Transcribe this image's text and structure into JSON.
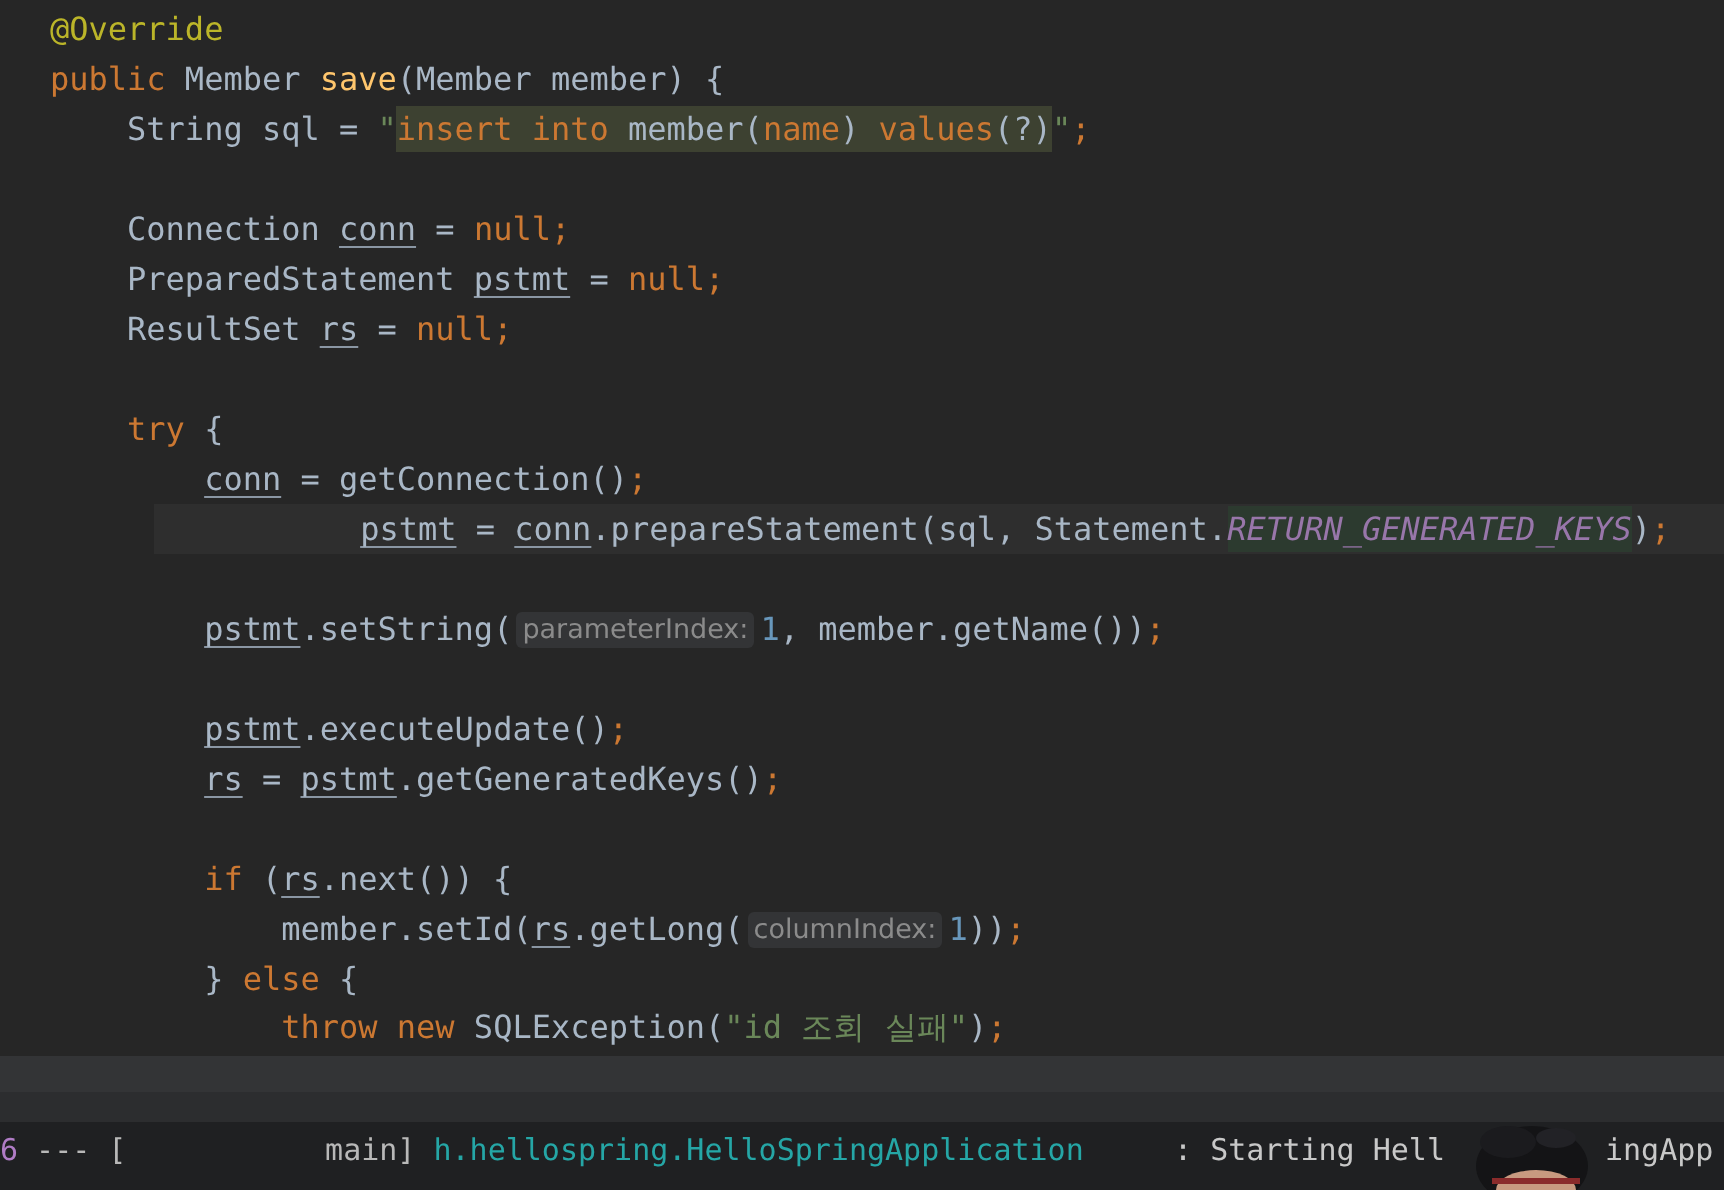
{
  "editor": {
    "lines": [
      {
        "kind": "code",
        "segments": [
          {
            "kind": "text",
            "tokens": [
              {
                "text": "@Override",
                "kind": "annotation"
              }
            ]
          }
        ]
      },
      {
        "kind": "code",
        "segments": [
          {
            "kind": "text",
            "tokens": [
              {
                "text": "public",
                "kind": "keyword"
              },
              {
                "text": " Member ",
                "kind": "plain"
              },
              {
                "text": "save",
                "kind": "method"
              },
              {
                "text": "(Member member) {",
                "kind": "plain"
              }
            ]
          }
        ],
        "children": [
          {
            "kind": "code",
            "segments": [
              {
                "kind": "text",
                "tokens": [
                  {
                    "text": "String sql = ",
                    "kind": "plain"
                  },
                  {
                    "text": "\"",
                    "kind": "string"
                  }
                ]
              },
              {
                "kind": "injection",
                "tokens": [
                  {
                    "text": "insert into",
                    "kind": "keyword"
                  },
                  {
                    "text": " member(",
                    "kind": "plain"
                  },
                  {
                    "text": "name",
                    "kind": "keyword"
                  },
                  {
                    "text": ") ",
                    "kind": "plain"
                  },
                  {
                    "text": "values",
                    "kind": "keyword"
                  },
                  {
                    "text": "(?)",
                    "kind": "plain"
                  }
                ]
              },
              {
                "kind": "text",
                "tokens": [
                  {
                    "text": "\"",
                    "kind": "string"
                  },
                  {
                    "text": ";",
                    "kind": "keyword"
                  }
                ]
              }
            ]
          },
          {
            "kind": "blank"
          },
          {
            "kind": "code",
            "segments": [
              {
                "kind": "text",
                "tokens": [
                  {
                    "text": "Connection ",
                    "kind": "plain"
                  },
                  {
                    "text": "conn",
                    "kind": "plain",
                    "underline": true
                  },
                  {
                    "text": " = ",
                    "kind": "plain"
                  },
                  {
                    "text": "null;",
                    "kind": "keyword"
                  }
                ]
              }
            ]
          },
          {
            "kind": "code",
            "segments": [
              {
                "kind": "text",
                "tokens": [
                  {
                    "text": "PreparedStatement ",
                    "kind": "plain"
                  },
                  {
                    "text": "pstmt",
                    "kind": "plain",
                    "underline": true
                  },
                  {
                    "text": " = ",
                    "kind": "plain"
                  },
                  {
                    "text": "null;",
                    "kind": "keyword"
                  }
                ]
              }
            ]
          },
          {
            "kind": "code",
            "segments": [
              {
                "kind": "text",
                "tokens": [
                  {
                    "text": "ResultSet ",
                    "kind": "plain"
                  },
                  {
                    "text": "rs",
                    "kind": "plain",
                    "underline": true
                  },
                  {
                    "text": " = ",
                    "kind": "plain"
                  },
                  {
                    "text": "null;",
                    "kind": "keyword"
                  }
                ]
              }
            ]
          },
          {
            "kind": "blank"
          },
          {
            "kind": "code",
            "segments": [
              {
                "kind": "text",
                "tokens": [
                  {
                    "text": "try",
                    "kind": "keyword"
                  },
                  {
                    "text": " {",
                    "kind": "plain"
                  }
                ]
              }
            ],
            "children": [
              {
                "kind": "code",
                "segments": [
                  {
                    "kind": "text",
                    "tokens": [
                      {
                        "text": "conn",
                        "kind": "plain",
                        "underline": true
                      },
                      {
                        "text": " = getConnection()",
                        "kind": "plain"
                      },
                      {
                        "text": ";",
                        "kind": "keyword"
                      }
                    ]
                  }
                ]
              },
              {
                "kind": "code",
                "current": true,
                "segments": [
                  {
                    "kind": "text",
                    "tokens": [
                      {
                        "text": "pstmt",
                        "kind": "plain",
                        "underline": true
                      },
                      {
                        "text": " = ",
                        "kind": "plain"
                      },
                      {
                        "text": "conn",
                        "kind": "plain",
                        "underline": true
                      },
                      {
                        "text": ".prepareStatement(sql, Statement.",
                        "kind": "plain"
                      }
                    ]
                  },
                  {
                    "kind": "usage",
                    "tokens": [
                      {
                        "text": "RETURN_GENERATED_KEYS",
                        "kind": "constant"
                      }
                    ]
                  },
                  {
                    "kind": "text",
                    "tokens": [
                      {
                        "text": ")",
                        "kind": "plain"
                      },
                      {
                        "text": ";",
                        "kind": "keyword"
                      }
                    ]
                  }
                ]
              },
              {
                "kind": "blank"
              },
              {
                "kind": "code",
                "segments": [
                  {
                    "kind": "text",
                    "tokens": [
                      {
                        "text": "pstmt",
                        "kind": "plain",
                        "underline": true
                      },
                      {
                        "text": ".setString(",
                        "kind": "plain"
                      }
                    ]
                  },
                  {
                    "kind": "hint",
                    "text": "parameterIndex:"
                  },
                  {
                    "kind": "text",
                    "tokens": [
                      {
                        "text": "1",
                        "kind": "number"
                      },
                      {
                        "text": ", member.getName())",
                        "kind": "plain"
                      },
                      {
                        "text": ";",
                        "kind": "keyword"
                      }
                    ]
                  }
                ]
              },
              {
                "kind": "blank"
              },
              {
                "kind": "code",
                "segments": [
                  {
                    "kind": "text",
                    "tokens": [
                      {
                        "text": "pstmt",
                        "kind": "plain",
                        "underline": true
                      },
                      {
                        "text": ".executeUpdate()",
                        "kind": "plain"
                      },
                      {
                        "text": ";",
                        "kind": "keyword"
                      }
                    ]
                  }
                ]
              },
              {
                "kind": "code",
                "segments": [
                  {
                    "kind": "text",
                    "tokens": [
                      {
                        "text": "rs",
                        "kind": "plain",
                        "underline": true
                      },
                      {
                        "text": " = ",
                        "kind": "plain"
                      },
                      {
                        "text": "pstmt",
                        "kind": "plain",
                        "underline": true
                      },
                      {
                        "text": ".getGeneratedKeys()",
                        "kind": "plain"
                      },
                      {
                        "text": ";",
                        "kind": "keyword"
                      }
                    ]
                  }
                ]
              },
              {
                "kind": "blank"
              },
              {
                "kind": "code",
                "segments": [
                  {
                    "kind": "text",
                    "tokens": [
                      {
                        "text": "if",
                        "kind": "keyword"
                      },
                      {
                        "text": " (",
                        "kind": "plain"
                      },
                      {
                        "text": "rs",
                        "kind": "plain",
                        "underline": true
                      },
                      {
                        "text": ".next()) {",
                        "kind": "plain"
                      }
                    ]
                  }
                ],
                "children": [
                  {
                    "kind": "code",
                    "segments": [
                      {
                        "kind": "text",
                        "tokens": [
                          {
                            "text": "member.setId(",
                            "kind": "plain"
                          },
                          {
                            "text": "rs",
                            "kind": "plain",
                            "underline": true
                          },
                          {
                            "text": ".getLong(",
                            "kind": "plain"
                          }
                        ]
                      },
                      {
                        "kind": "hint",
                        "text": "columnIndex:"
                      },
                      {
                        "kind": "text",
                        "tokens": [
                          {
                            "text": "1",
                            "kind": "number"
                          },
                          {
                            "text": "))",
                            "kind": "plain"
                          },
                          {
                            "text": ";",
                            "kind": "keyword"
                          }
                        ]
                      }
                    ]
                  }
                ]
              },
              {
                "kind": "code",
                "segments": [
                  {
                    "kind": "text",
                    "tokens": [
                      {
                        "text": "} ",
                        "kind": "plain"
                      },
                      {
                        "text": "else",
                        "kind": "keyword"
                      },
                      {
                        "text": " {",
                        "kind": "plain"
                      }
                    ]
                  }
                ],
                "children": [
                  {
                    "kind": "code",
                    "segments": [
                      {
                        "kind": "text",
                        "tokens": [
                          {
                            "text": "throw new",
                            "kind": "keyword"
                          },
                          {
                            "text": " SQLException(",
                            "kind": "plain"
                          },
                          {
                            "text": "\"id 조회 실패\"",
                            "kind": "string"
                          },
                          {
                            "text": ")",
                            "kind": "plain"
                          },
                          {
                            "text": ";",
                            "kind": "keyword"
                          }
                        ]
                      }
                    ]
                  }
                ]
              }
            ]
          }
        ]
      }
    ]
  },
  "console": {
    "lines": [
      {
        "kind": "code",
        "segments": [
          {
            "kind": "text",
            "tokens": [
              {
                "text": "6",
                "kind": "pid"
              },
              {
                "text": " --- [           main] ",
                "kind": "dim"
              },
              {
                "text": "h.hellospring.HelloSpringApplication",
                "kind": "logger"
              },
              {
                "text": "     : Starting Hell",
                "kind": "message"
              }
            ]
          },
          {
            "kind": "tail",
            "tokens": [
              {
                "text": "ingApp",
                "kind": "message"
              }
            ]
          }
        ]
      }
    ]
  }
}
